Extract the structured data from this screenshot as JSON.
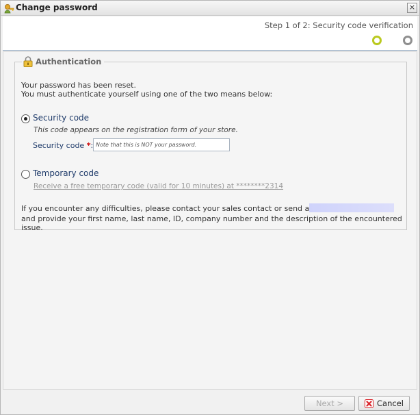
{
  "window": {
    "title": "Change password",
    "close_glyph": "×"
  },
  "step": {
    "text": "Step 1 of 2: Security code verification"
  },
  "auth": {
    "legend": "Authentication",
    "intro_line1": "Your password has been reset.",
    "intro_line2": "You must authenticate yourself using one of the two means below:",
    "security_option": {
      "label": "Security code",
      "selected": true,
      "description": "This code appears on the registration form of your store.",
      "field_label": "Security code",
      "required_mark": "*",
      "field_suffix": ":",
      "placeholder": "Note that this is NOT your password.",
      "value": ""
    },
    "temporary_option": {
      "label": "Temporary code",
      "selected": false,
      "link_text": "Receive a free temporary code (valid for 10 minutes) at ********2314"
    },
    "help_line1": "If you encounter any difficulties, please contact your sales contact or send an e-mail to",
    "help_line2": "and provide your first name, last name, ID, company number and the description of the encountered issue."
  },
  "footer": {
    "next_label": "Next >",
    "cancel_label": "Cancel"
  },
  "icons": {
    "title": "key-user-icon",
    "lock": "padlock-icon",
    "cancel": "red-x-icon"
  },
  "colors": {
    "step_active": "#bac91f",
    "step_inactive": "#8f8f8f",
    "label_blue": "#1f3b6a",
    "required_red": "#cc0000",
    "cancel_red": "#d9262c"
  }
}
